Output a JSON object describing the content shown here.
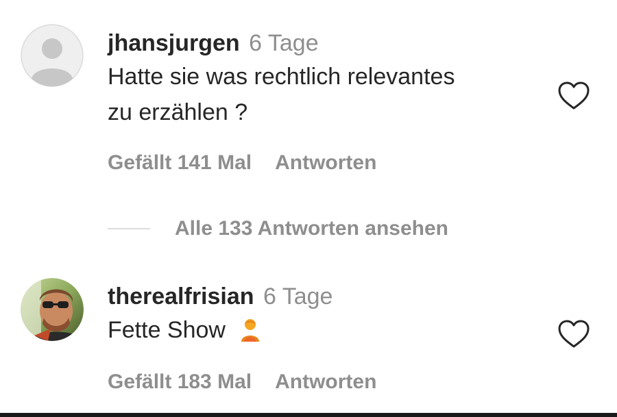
{
  "comments": [
    {
      "username": "jhansjurgen",
      "timestamp": "6 Tage",
      "text_line1": "Hatte sie was rechtlich relevantes",
      "text_line2": "zu erzählen ?",
      "likes_label": "Gefällt 141 Mal",
      "reply_label": "Antworten",
      "avatar_icon": "default-user-avatar-icon",
      "like_icon": "heart-outline-icon"
    },
    {
      "username": "therealfrisian",
      "timestamp": "6 Tage",
      "text": "Fette Show",
      "emoji_icon": "person-emoji-icon",
      "likes_label": "Gefällt 183 Mal",
      "reply_label": "Antworten",
      "avatar_icon": "user-photo-avatar",
      "like_icon": "heart-outline-icon"
    }
  ],
  "view_replies": {
    "label": "Alle 133 Antworten ansehen"
  },
  "colors": {
    "primary_text": "#262626",
    "secondary_text": "#8e8e8e",
    "divider": "#dbdbdb",
    "avatar_bg": "#efefef",
    "avatar_fg": "#c7c7c7"
  }
}
